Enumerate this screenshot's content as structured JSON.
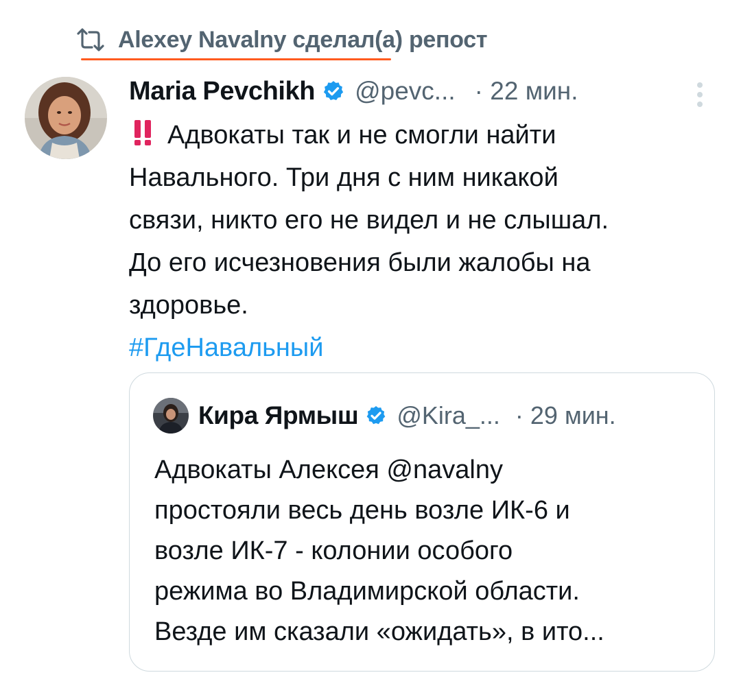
{
  "repost": {
    "icon": "repost-icon",
    "text": "Alexey Navalny сделал(а) репост",
    "underline_color": "#ff5a1f"
  },
  "tweet": {
    "author_name": "Maria Pevchikh",
    "verified_icon": "verified-badge-icon",
    "handle": "@pevc...",
    "time": "· 22 мин.",
    "body_lines": [
      "Адвокаты так и не смогли найти",
      "Навального. Три дня с ним никакой",
      "связи, никто его не видел и не слышал.",
      "До его исчезновения были жалобы на",
      "здоровье."
    ],
    "hashtag": "#ГдеНавальный",
    "alert_icon": "double-exclamation-icon"
  },
  "quote": {
    "author_name": "Кира Ярмыш",
    "handle": "@Kira_...",
    "time": "· 29 мин.",
    "body_lines": [
      "Адвокаты Алексея @navalny",
      "простояли весь день возле ИК-6 и",
      "возле ИК-7 - колонии особого",
      "режима во Владимирской области.",
      "Везде им сказали «ожидать», в ито..."
    ]
  },
  "colors": {
    "text_primary": "#0f1419",
    "text_secondary": "#536471",
    "link": "#1d9bf0",
    "border": "#cfd9de",
    "alert": "#e0245e"
  }
}
